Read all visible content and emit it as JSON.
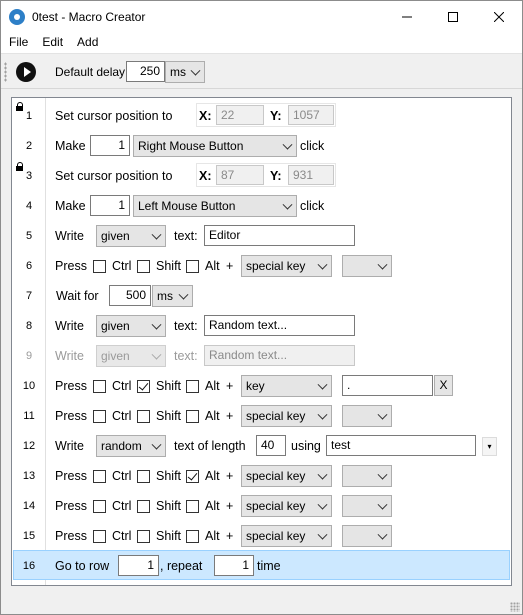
{
  "window": {
    "title": "0test - Macro Creator",
    "icon": "gear-icon"
  },
  "menu": [
    "File",
    "Edit",
    "Add"
  ],
  "toolbar": {
    "play_icon": "play-icon",
    "delay_label": "Default delay",
    "delay_value": "250",
    "delay_unit": "ms"
  },
  "rows": [
    {
      "num": "1",
      "locked": true,
      "kind": "set_cursor",
      "label": "Set cursor position to",
      "x_label": "X:",
      "x": "22",
      "y_label": "Y:",
      "y": "1057"
    },
    {
      "num": "2",
      "kind": "click",
      "label": "Make",
      "count": "1",
      "button": "Right Mouse Button",
      "suffix": "click"
    },
    {
      "num": "3",
      "locked": true,
      "kind": "set_cursor",
      "label": "Set cursor position to",
      "x_label": "X:",
      "x": "87",
      "y_label": "Y:",
      "y": "931"
    },
    {
      "num": "4",
      "kind": "click",
      "label": "Make",
      "count": "1",
      "button": "Left Mouse Button",
      "suffix": "click"
    },
    {
      "num": "5",
      "kind": "write",
      "label": "Write",
      "mode": "given",
      "text_label": "text:",
      "text": "Editor"
    },
    {
      "num": "6",
      "kind": "press",
      "label": "Press",
      "ctrl": "Ctrl",
      "shift": "Shift",
      "alt": "Alt",
      "plus": "+",
      "key_type": "special key",
      "key_value": ""
    },
    {
      "num": "7",
      "kind": "wait",
      "label": "Wait for",
      "amount": "500",
      "unit": "ms"
    },
    {
      "num": "8",
      "kind": "write",
      "label": "Write",
      "mode": "given",
      "text_label": "text:",
      "text": "Random text..."
    },
    {
      "num": "9",
      "kind": "write",
      "disabled": true,
      "label": "Write",
      "mode": "given",
      "text_label": "text:",
      "text": "Random text..."
    },
    {
      "num": "10",
      "kind": "press_key",
      "label": "Press",
      "ctrl": "Ctrl",
      "shift": "Shift",
      "alt": "Alt",
      "plus": "+",
      "key_type": "key",
      "key_value": ".",
      "clear": "X"
    },
    {
      "num": "11",
      "kind": "press",
      "label": "Press",
      "ctrl": "Ctrl",
      "shift": "Shift",
      "alt": "Alt",
      "plus": "+",
      "key_type": "special key",
      "key_value": ""
    },
    {
      "num": "12",
      "kind": "write_random",
      "label": "Write",
      "mode": "random",
      "length_label": "text of length",
      "length": "40",
      "using_label": "using",
      "charset": "test"
    },
    {
      "num": "13",
      "kind": "press",
      "label": "Press",
      "ctrl": "Ctrl",
      "shift": "Shift",
      "alt": "Alt",
      "plus": "+",
      "key_type": "special key",
      "key_value": ""
    },
    {
      "num": "14",
      "kind": "press",
      "label": "Press",
      "ctrl": "Ctrl",
      "shift": "Shift",
      "alt": "Alt",
      "plus": "+",
      "key_type": "special key",
      "key_value": ""
    },
    {
      "num": "15",
      "kind": "press",
      "label": "Press",
      "ctrl": "Ctrl",
      "shift": "Shift",
      "alt": "Alt",
      "plus": "+",
      "key_type": "special key",
      "key_value": ""
    },
    {
      "num": "16",
      "kind": "goto",
      "label": "Go to row",
      "row": "1",
      "comma": ", repeat",
      "times": "1",
      "suffix": "time"
    }
  ],
  "checks": {
    "row10_shift": true,
    "row13_alt": true
  }
}
